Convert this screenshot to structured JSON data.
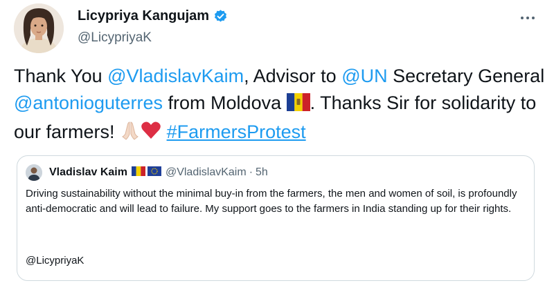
{
  "author": {
    "display_name": "Licypriya Kangujam",
    "handle": "@LicypriyaK",
    "verified": true,
    "verified_icon": "verified-badge-icon"
  },
  "tweet": {
    "text_1": "Thank You ",
    "mention_1": "@VladislavKaim",
    "text_2": ", Advisor to ",
    "mention_2": "@UN",
    "text_3": " Secretary General ",
    "mention_3": "@antonioguterres",
    "text_4": " from Moldova ",
    "flag_1": "moldova-flag-icon",
    "text_5": ". Thanks Sir for solidarity to our farmers! ",
    "emoji_1": "folded-hands-icon",
    "emoji_2": "red-heart-icon",
    "text_6": " ",
    "hashtag": "#FarmersProtest"
  },
  "quoted_tweet": {
    "author_name": "Vladislav Kaim",
    "flags": [
      "moldova-flag-icon",
      "eu-flag-icon"
    ],
    "handle": "@VladislavKaim",
    "separator": "·",
    "time": "5h",
    "text": "Driving sustainability without the minimal buy-in from the farmers, the men and women of soil, is profoundly anti-democratic and will lead to failure. My support goes to the farmers in India standing up for their rights.",
    "mention_line": "@LicypriyaK"
  },
  "colors": {
    "link": "#1d9bf0",
    "text": "#0f1419",
    "secondary": "#536471",
    "border": "#cfd9de"
  }
}
